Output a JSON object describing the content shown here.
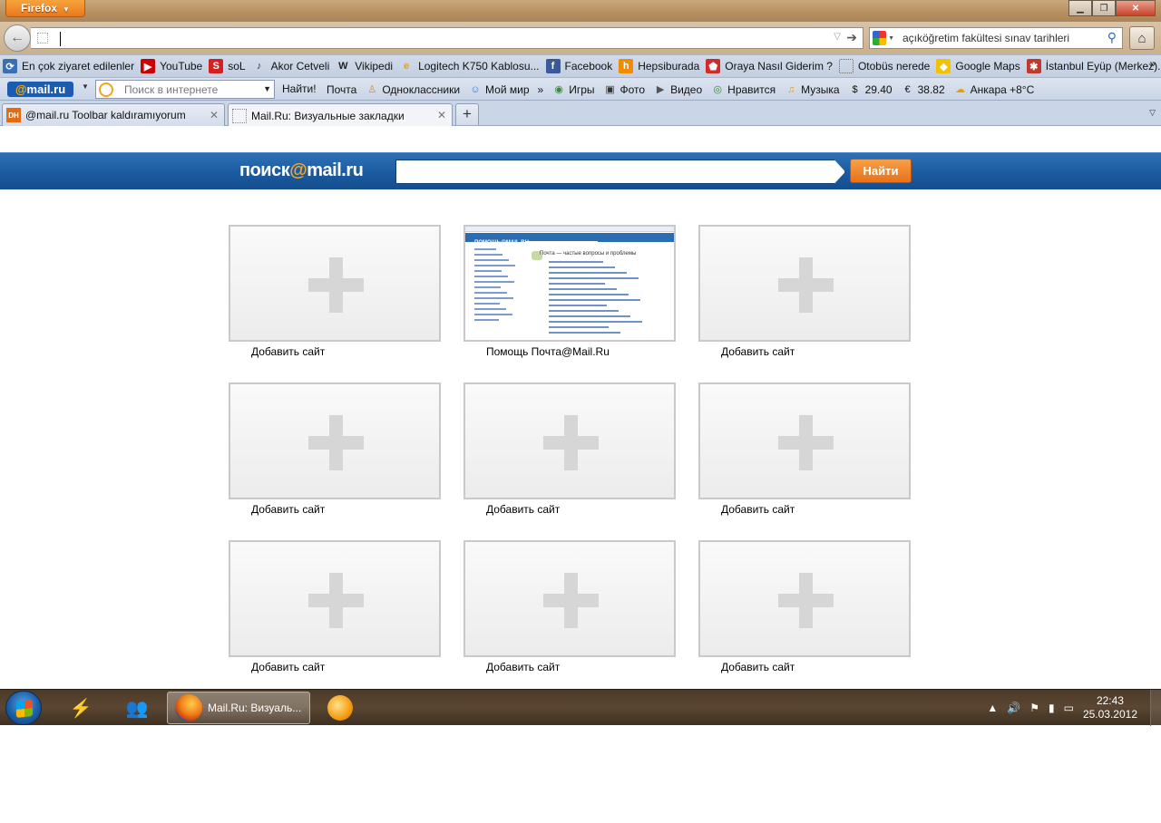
{
  "browser": {
    "menu_button": "Firefox",
    "url": "",
    "search": {
      "engine_icon": "google-icon",
      "value": "açıköğretim fakültesi sınav tarihleri"
    }
  },
  "bookmarks": [
    {
      "label": "En çok ziyaret edilenler",
      "icon": "most-visited-icon",
      "color": "#3a6fb0"
    },
    {
      "label": "YouTube",
      "icon": "youtube-icon",
      "color": "#cc0000"
    },
    {
      "label": "soL",
      "icon": "sol-icon",
      "color": "#d32020"
    },
    {
      "label": "Akor Cetveli",
      "icon": "music-note-icon",
      "color": "#333333"
    },
    {
      "label": "Vikipedi",
      "icon": "wikipedia-icon",
      "color": "#222222"
    },
    {
      "label": "Logitech K750 Kablosu...",
      "icon": "page-icon",
      "color": "#e0a020"
    },
    {
      "label": "Facebook",
      "icon": "facebook-icon",
      "color": "#3b5998"
    },
    {
      "label": "Hepsiburada",
      "icon": "hepsiburada-icon",
      "color": "#f28b00"
    },
    {
      "label": "Oraya Nasıl Giderim ?",
      "icon": "oraya-icon",
      "color": "#d02a2a"
    },
    {
      "label": "Otobüs nerede",
      "icon": "blank-page-icon",
      "color": "#ffffff"
    },
    {
      "label": "Google Maps",
      "icon": "maps-pin-icon",
      "color": "#f2c200"
    },
    {
      "label": "İstanbul Eyüp (Merkez)...",
      "icon": "mosque-icon",
      "color": "#c0392b"
    }
  ],
  "mailbar": {
    "logo": {
      "at": "@",
      "name": "mail.ru"
    },
    "search_placeholder": "Поиск в интернете",
    "find_label": "Найти!",
    "items": [
      {
        "label": "Почта",
        "icon": ""
      },
      {
        "label": "Одноклассники",
        "icon": "odnoklassniki-icon"
      },
      {
        "label": "Мой мир",
        "icon": "my-world-icon"
      },
      {
        "label": "Игры",
        "icon": "games-icon"
      },
      {
        "label": "Фото",
        "icon": "photo-icon"
      },
      {
        "label": "Видео",
        "icon": "video-icon"
      },
      {
        "label": "Нравится",
        "icon": "like-icon"
      },
      {
        "label": "Музыка",
        "icon": "music-icon"
      },
      {
        "label": "29.40",
        "icon": "dollar-icon"
      },
      {
        "label": "38.82",
        "icon": "euro-icon"
      },
      {
        "label": "Анкара +8°C",
        "icon": "weather-icon"
      }
    ]
  },
  "tabs": [
    {
      "label": "@mail.ru Toolbar kaldıramıyorum",
      "favicon": "DH",
      "active": false
    },
    {
      "label": "Mail.Ru: Визуальные закладки",
      "favicon": "",
      "active": true
    }
  ],
  "page": {
    "logo_text": "поиск",
    "logo_at": "@",
    "logo_domain": "mail.ru",
    "search_button": "Найти",
    "tiles": [
      {
        "label": "Добавить сайт",
        "empty": true
      },
      {
        "label": "Помощь Почта@Mail.Ru",
        "empty": false
      },
      {
        "label": "Добавить сайт",
        "empty": true
      },
      {
        "label": "Добавить сайт",
        "empty": true
      },
      {
        "label": "Добавить сайт",
        "empty": true
      },
      {
        "label": "Добавить сайт",
        "empty": true
      },
      {
        "label": "Добавить сайт",
        "empty": true
      },
      {
        "label": "Добавить сайт",
        "empty": true
      },
      {
        "label": "Добавить сайт",
        "empty": true
      }
    ],
    "thumbnail": {
      "title": "Почта — частые вопросы и проблемы"
    }
  },
  "taskbar": {
    "active_app_label": "Mail.Ru: Визуаль...",
    "time": "22:43",
    "date": "25.03.2012"
  }
}
